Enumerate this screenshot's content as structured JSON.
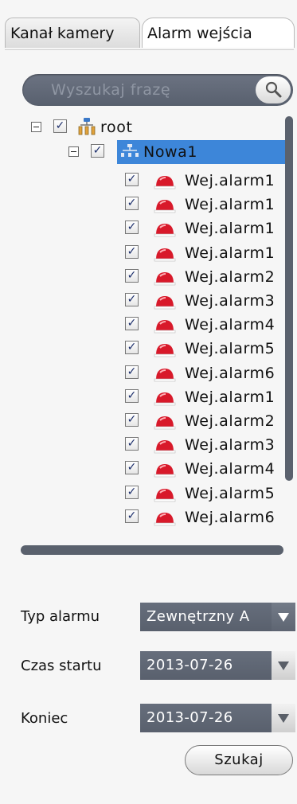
{
  "tabs": [
    {
      "label": "Kanał kamery"
    },
    {
      "label": "Alarm wejścia"
    }
  ],
  "search": {
    "placeholder": "Wyszukaj frazę"
  },
  "tree": {
    "root": {
      "label": "root",
      "checked": true,
      "expanded": true
    },
    "group": {
      "label": "Nowa1",
      "checked": true,
      "expanded": true,
      "selected": true
    },
    "items": [
      {
        "label": "Wej.alarm1",
        "checked": true
      },
      {
        "label": "Wej.alarm1",
        "checked": true
      },
      {
        "label": "Wej.alarm1",
        "checked": true
      },
      {
        "label": "Wej.alarm1",
        "checked": true
      },
      {
        "label": "Wej.alarm2",
        "checked": true
      },
      {
        "label": "Wej.alarm3",
        "checked": true
      },
      {
        "label": "Wej.alarm4",
        "checked": true
      },
      {
        "label": "Wej.alarm5",
        "checked": true
      },
      {
        "label": "Wej.alarm6",
        "checked": true
      },
      {
        "label": "Wej.alarm1",
        "checked": true
      },
      {
        "label": "Wej.alarm2",
        "checked": true
      },
      {
        "label": "Wej.alarm3",
        "checked": true
      },
      {
        "label": "Wej.alarm4",
        "checked": true
      },
      {
        "label": "Wej.alarm5",
        "checked": true
      },
      {
        "label": "Wej.alarm6",
        "checked": true
      }
    ]
  },
  "form": {
    "alarm_type": {
      "label": "Typ alarmu",
      "value": "Zewnętrzny A"
    },
    "start_time": {
      "label": "Czas startu",
      "value": "2013-07-26"
    },
    "end_time": {
      "label": "Koniec",
      "value": "2013-07-26"
    }
  },
  "search_button": {
    "label": "Szukaj"
  },
  "colors": {
    "selection": "#3d86d9",
    "dark_control": "#5a616d",
    "alarm_icon": "#d8192a"
  }
}
